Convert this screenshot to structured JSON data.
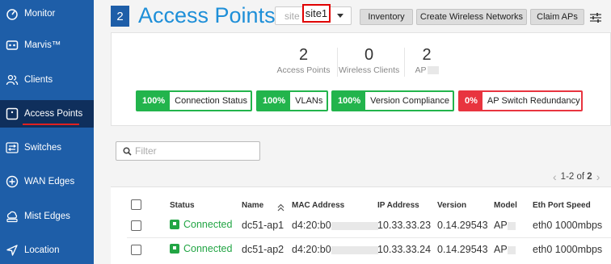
{
  "sidebar": {
    "items": [
      {
        "label": "Monitor",
        "icon": "monitor-icon"
      },
      {
        "label": "Marvis™",
        "icon": "marvis-icon"
      },
      {
        "label": "Clients",
        "icon": "clients-icon"
      },
      {
        "label": "Access Points",
        "icon": "access-point-icon",
        "active": true
      },
      {
        "label": "Switches",
        "icon": "switch-icon"
      },
      {
        "label": "WAN Edges",
        "icon": "wan-edge-icon"
      },
      {
        "label": "Mist Edges",
        "icon": "mist-edge-icon"
      },
      {
        "label": "Location",
        "icon": "location-icon"
      }
    ]
  },
  "header": {
    "badge": "2",
    "title": "Access Points",
    "site_prefix": "site",
    "site_value": "site1",
    "buttons": {
      "inventory": "Inventory",
      "create_wlan": "Create Wireless Networks",
      "claim": "Claim APs"
    }
  },
  "stats": {
    "access_points": {
      "value": "2",
      "label": "Access Points"
    },
    "wireless_clients": {
      "value": "0",
      "label": "Wireless Clients"
    },
    "ap_third": {
      "value": "2",
      "label": "AP"
    }
  },
  "sle": [
    {
      "pct": "100%",
      "name": "Connection Status",
      "status": "good"
    },
    {
      "pct": "100%",
      "name": "VLANs",
      "status": "good"
    },
    {
      "pct": "100%",
      "name": "Version Compliance",
      "status": "good"
    },
    {
      "pct": "0%",
      "name": "AP Switch Redundancy",
      "status": "bad"
    }
  ],
  "filter": {
    "placeholder": "Filter"
  },
  "pagination": {
    "range": "1-2 of",
    "total": "2"
  },
  "table": {
    "headers": {
      "status": "Status",
      "name": "Name",
      "mac": "MAC Address",
      "ip": "IP Address",
      "version": "Version",
      "model": "Model",
      "eth": "Eth Port Speed"
    },
    "rows": [
      {
        "status": "Connected",
        "name": "dc51-ap1",
        "mac": "d4:20:b0",
        "ip": "10.33.33.23",
        "version": "0.14.29543",
        "model": "AP",
        "eth": "eth0 1000mbps"
      },
      {
        "status": "Connected",
        "name": "dc51-ap2",
        "mac": "d4:20:b0",
        "ip": "10.33.33.24",
        "version": "0.14.29543",
        "model": "AP",
        "eth": "eth0 1000mbps"
      }
    ]
  },
  "colors": {
    "sidebar": "#1e5ea8",
    "sidebar_active": "#0f2f5c",
    "title": "#1e8fd8",
    "good": "#22b44c",
    "bad": "#e8343f",
    "highlight": "#e00000"
  }
}
